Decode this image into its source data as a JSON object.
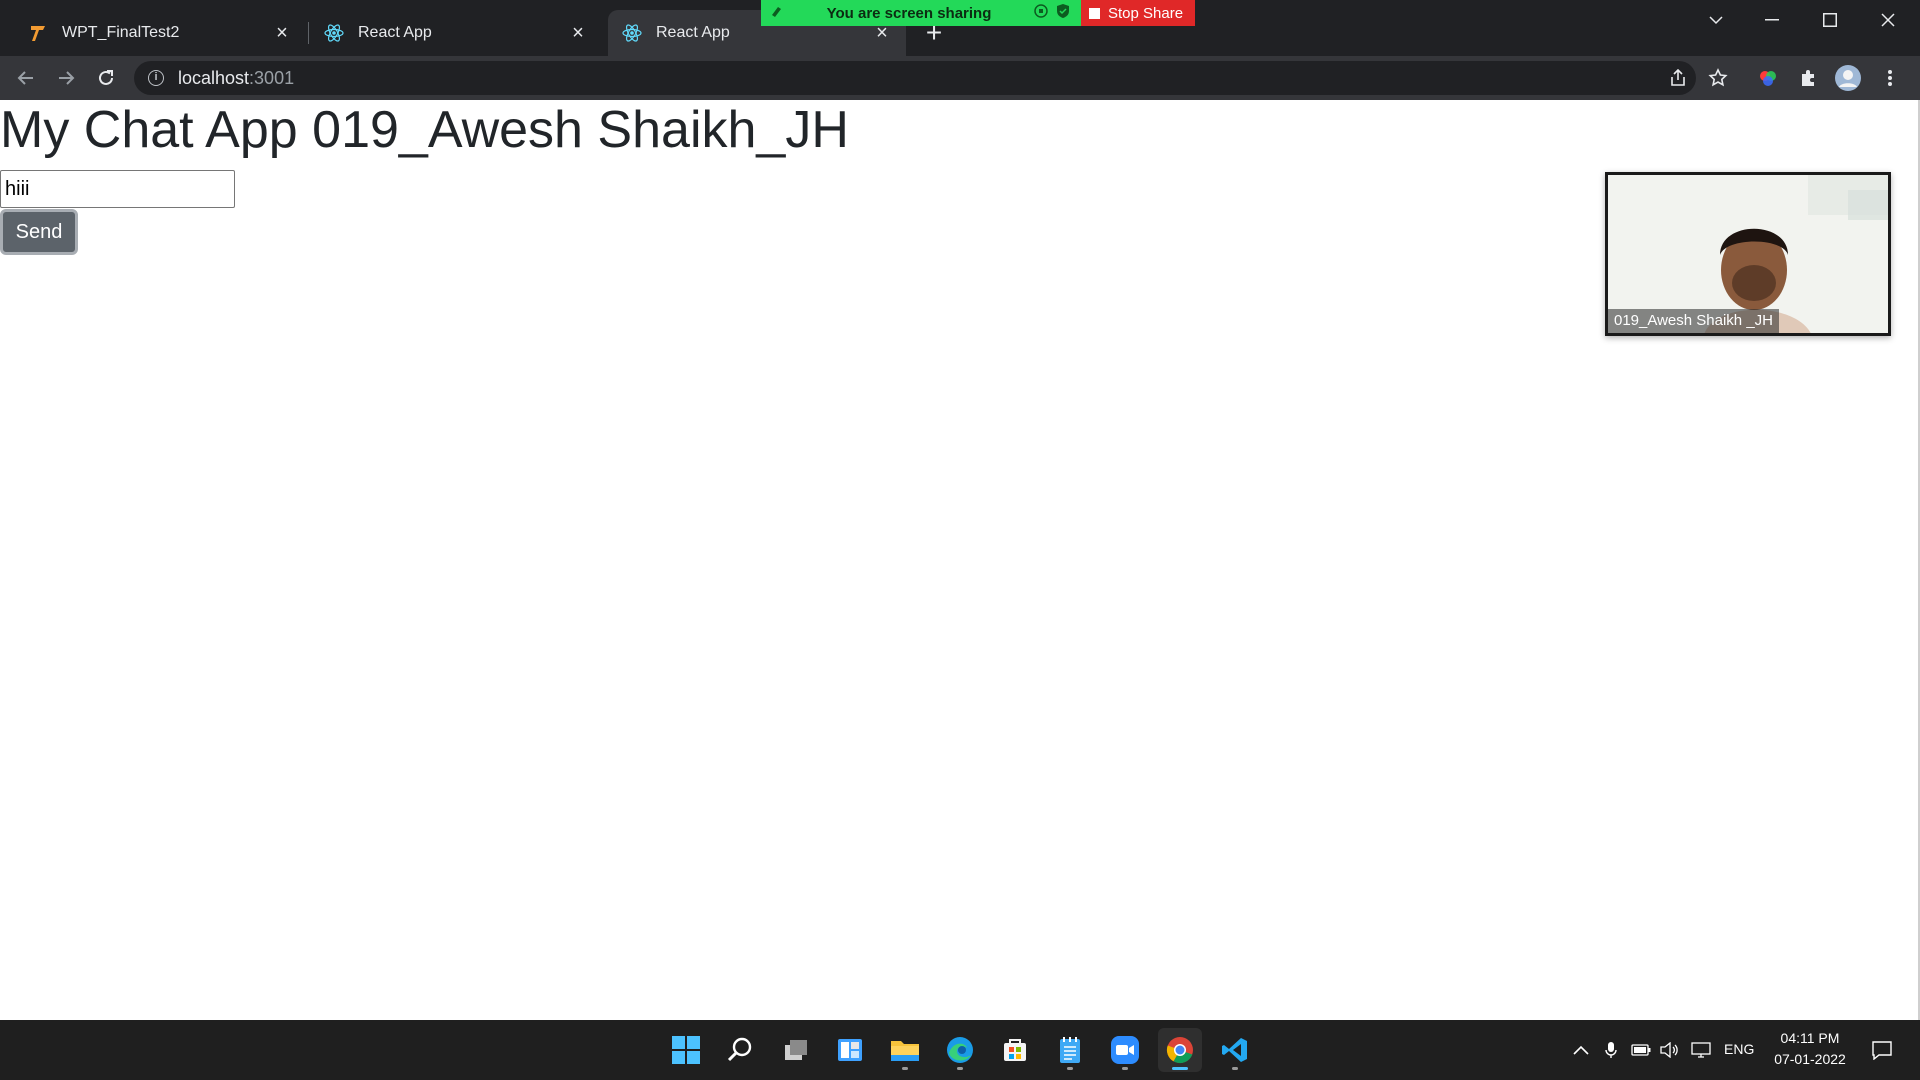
{
  "browser": {
    "tabs": [
      {
        "label": "WPT_FinalTest2",
        "icon": "tabnine-icon"
      },
      {
        "label": "React App",
        "icon": "react-icon"
      },
      {
        "label": "React App",
        "icon": "react-icon",
        "active": true
      }
    ],
    "new_tab": "+",
    "address": {
      "host": "localhost",
      "port": ":3001"
    }
  },
  "screen_share": {
    "banner_text": "You are screen sharing",
    "stop_label": "Stop Share",
    "banner_color": "#23d959",
    "stop_color": "#e02828"
  },
  "page": {
    "title": "My Chat App 019_Awesh Shaikh_JH",
    "message_input_value": "hiii",
    "send_label": "Send"
  },
  "video": {
    "participant_name": "019_Awesh Shaikh _JH"
  },
  "taskbar": {
    "apps": [
      "windows-start-icon",
      "search-icon",
      "task-view-icon",
      "widgets-icon",
      "file-explorer-icon",
      "edge-icon",
      "store-icon",
      "notepad-icon",
      "zoom-icon",
      "chrome-icon",
      "vscode-icon"
    ],
    "tray": {
      "language": "ENG",
      "time": "04:11 PM",
      "date": "07-01-2022"
    }
  }
}
